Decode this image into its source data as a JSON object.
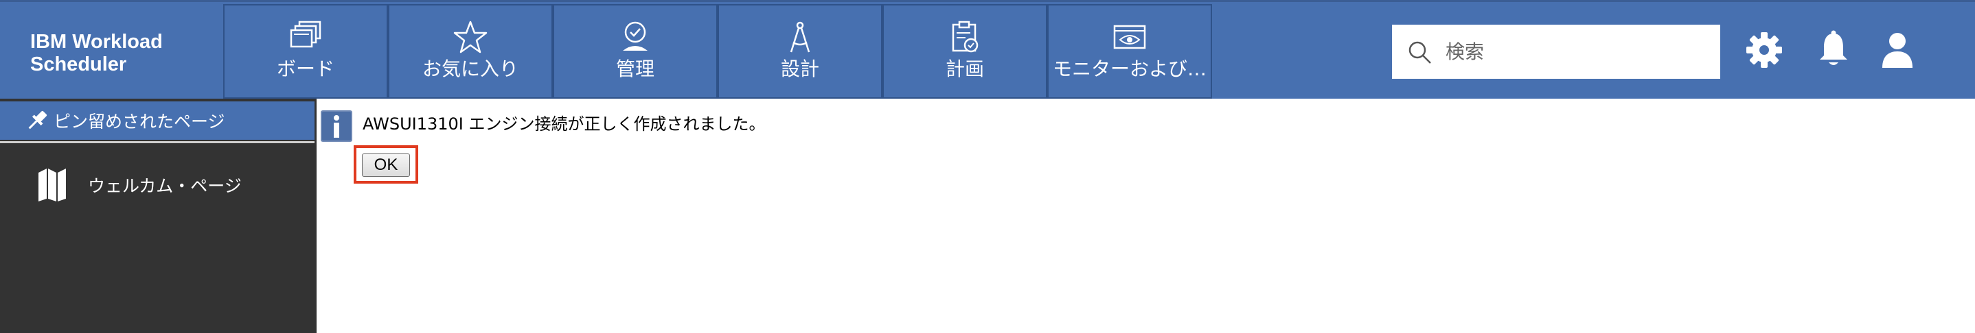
{
  "header": {
    "brand_line1": "IBM Workload",
    "brand_line2": "Scheduler",
    "tabs": [
      {
        "label": "ボード",
        "icon": "boards-icon"
      },
      {
        "label": "お気に入り",
        "icon": "star-icon"
      },
      {
        "label": "管理",
        "icon": "admin-user-icon"
      },
      {
        "label": "設計",
        "icon": "compass-icon"
      },
      {
        "label": "計画",
        "icon": "clipboard-icon"
      },
      {
        "label": "モニターおよび…",
        "icon": "monitor-eye-icon"
      }
    ],
    "search": {
      "placeholder": "検索",
      "value": ""
    },
    "icons": [
      "gear-icon",
      "bell-icon",
      "user-icon"
    ]
  },
  "sidebar": {
    "pinned_label": "ピン留めされたページ",
    "items": [
      {
        "label": "ウェルカム・ページ",
        "icon": "map-icon"
      }
    ]
  },
  "main": {
    "message": "AWSUI1310I エンジン接続が正しく作成されました。",
    "ok_label": "OK"
  },
  "colors": {
    "header_bg": "#4770b0",
    "sidebar_bg": "#333333",
    "highlight": "#e03a1f"
  }
}
